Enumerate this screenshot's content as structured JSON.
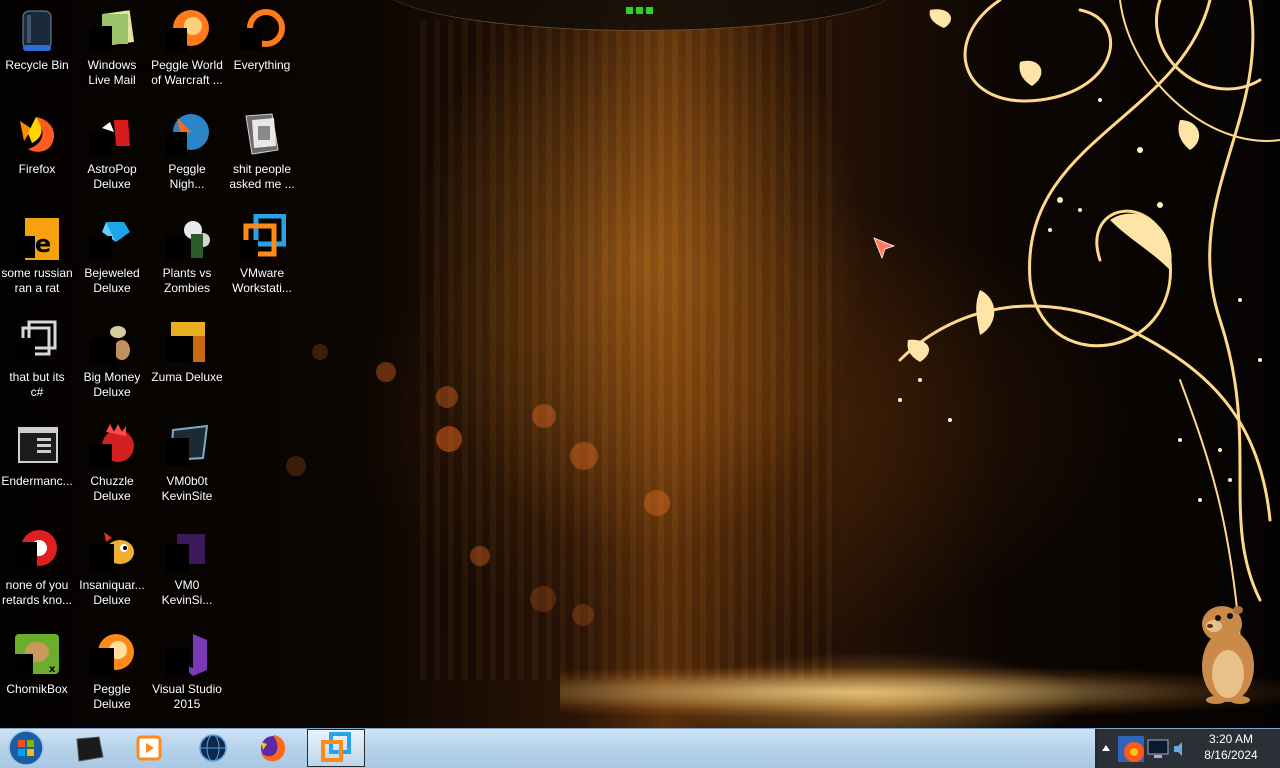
{
  "desktop": {
    "icons": [
      {
        "label": "Recycle Bin"
      },
      {
        "label": "Windows\nLive Mail"
      },
      {
        "label": "Peggle World\nof Warcraft ..."
      },
      {
        "label": "Everything"
      },
      {
        "label": "Firefox"
      },
      {
        "label": "AstroPop\nDeluxe"
      },
      {
        "label": "Peggle\nNigh..."
      },
      {
        "label": "shit people\nasked me ..."
      },
      {
        "label": "some russian\nran a rat"
      },
      {
        "label": "Bejeweled\nDeluxe"
      },
      {
        "label": "Plants vs\nZombies"
      },
      {
        "label": "VMware\nWorkstati..."
      },
      {
        "label": "that but its\nc#"
      },
      {
        "label": "Big Money\nDeluxe"
      },
      {
        "label": "Zuma Deluxe"
      },
      {
        "label": "Endermanc..."
      },
      {
        "label": "Chuzzle\nDeluxe"
      },
      {
        "label": "VM0b0t\nKevinSite"
      },
      {
        "label": "none of you\nretards kno..."
      },
      {
        "label": "Insaniquar...\nDeluxe"
      },
      {
        "label": "VM0\nKevinSi..."
      },
      {
        "label": "ChomikBox"
      },
      {
        "label": "Peggle\nDeluxe"
      },
      {
        "label": "Visual Studio\n2015"
      }
    ]
  },
  "taskbar": {
    "pinned": [
      {
        "name": "terminal-icon"
      },
      {
        "name": "media-player-icon"
      },
      {
        "name": "globe-icon"
      },
      {
        "name": "firefox-icon"
      },
      {
        "name": "vmware-icon",
        "active": true
      }
    ]
  },
  "tray": {
    "time": "3:20 AM",
    "date": "8/16/2024"
  },
  "colors": {
    "taskbar": "#b5d2ea",
    "label_text": "#ffffff",
    "accent_gold": "#ffd27a"
  }
}
